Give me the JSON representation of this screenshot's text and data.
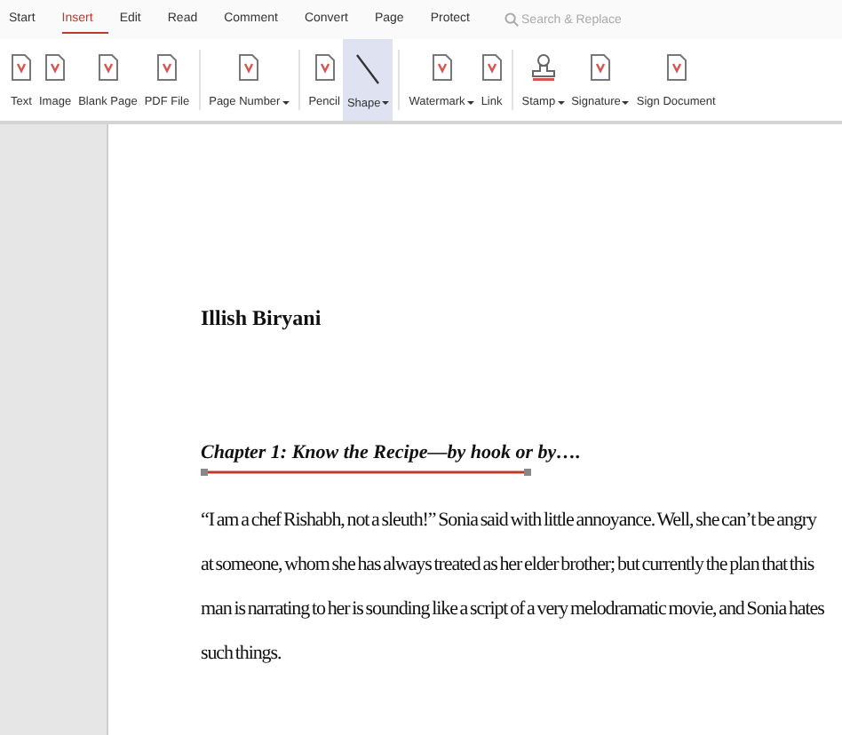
{
  "menu_tabs": [
    {
      "label": "Start",
      "selected": false
    },
    {
      "label": "Insert",
      "selected": true
    },
    {
      "label": "Edit",
      "selected": false
    },
    {
      "label": "Read",
      "selected": false
    },
    {
      "label": "Comment",
      "selected": false
    },
    {
      "label": "Convert",
      "selected": false
    },
    {
      "label": "Page",
      "selected": false
    },
    {
      "label": "Protect",
      "selected": false
    }
  ],
  "search": {
    "placeholder": "Search & Replace"
  },
  "toolbar": [
    {
      "label": "Text",
      "kind": "doc",
      "dropdown": false,
      "selected": false,
      "separator_before": false
    },
    {
      "label": "Image",
      "kind": "doc",
      "dropdown": false,
      "selected": false,
      "separator_before": false
    },
    {
      "label": "Blank Page",
      "kind": "doc",
      "dropdown": false,
      "selected": false,
      "separator_before": false
    },
    {
      "label": "PDF File",
      "kind": "doc",
      "dropdown": false,
      "selected": false,
      "separator_before": false
    },
    {
      "label": "Page Number",
      "kind": "doc",
      "dropdown": true,
      "selected": false,
      "separator_before": true
    },
    {
      "label": "Pencil",
      "kind": "doc",
      "dropdown": false,
      "selected": false,
      "separator_before": true
    },
    {
      "label": "Shape",
      "kind": "line",
      "dropdown": true,
      "selected": true,
      "separator_before": false
    },
    {
      "label": "Watermark",
      "kind": "doc",
      "dropdown": true,
      "selected": false,
      "separator_before": true
    },
    {
      "label": "Link",
      "kind": "doc",
      "dropdown": false,
      "selected": false,
      "separator_before": false
    },
    {
      "label": "Stamp",
      "kind": "stamp",
      "dropdown": true,
      "selected": false,
      "separator_before": true
    },
    {
      "label": "Signature",
      "kind": "doc",
      "dropdown": true,
      "selected": false,
      "separator_before": false
    },
    {
      "label": "Sign Document",
      "kind": "doc",
      "dropdown": false,
      "selected": false,
      "separator_before": false
    }
  ],
  "document": {
    "title": "Illish Biryani",
    "chapter": "Chapter 1: Know the Recipe—by hook or by….",
    "paragraph": "“I am a chef Rishabh, not a sleuth!” Sonia said with little annoyance. Well, she can’t be angry at someone, whom she has always treated as her elder brother; but currently the plan that this man is narrating to her is sounding like a script of a very melodramatic movie, and Sonia hates such things."
  }
}
